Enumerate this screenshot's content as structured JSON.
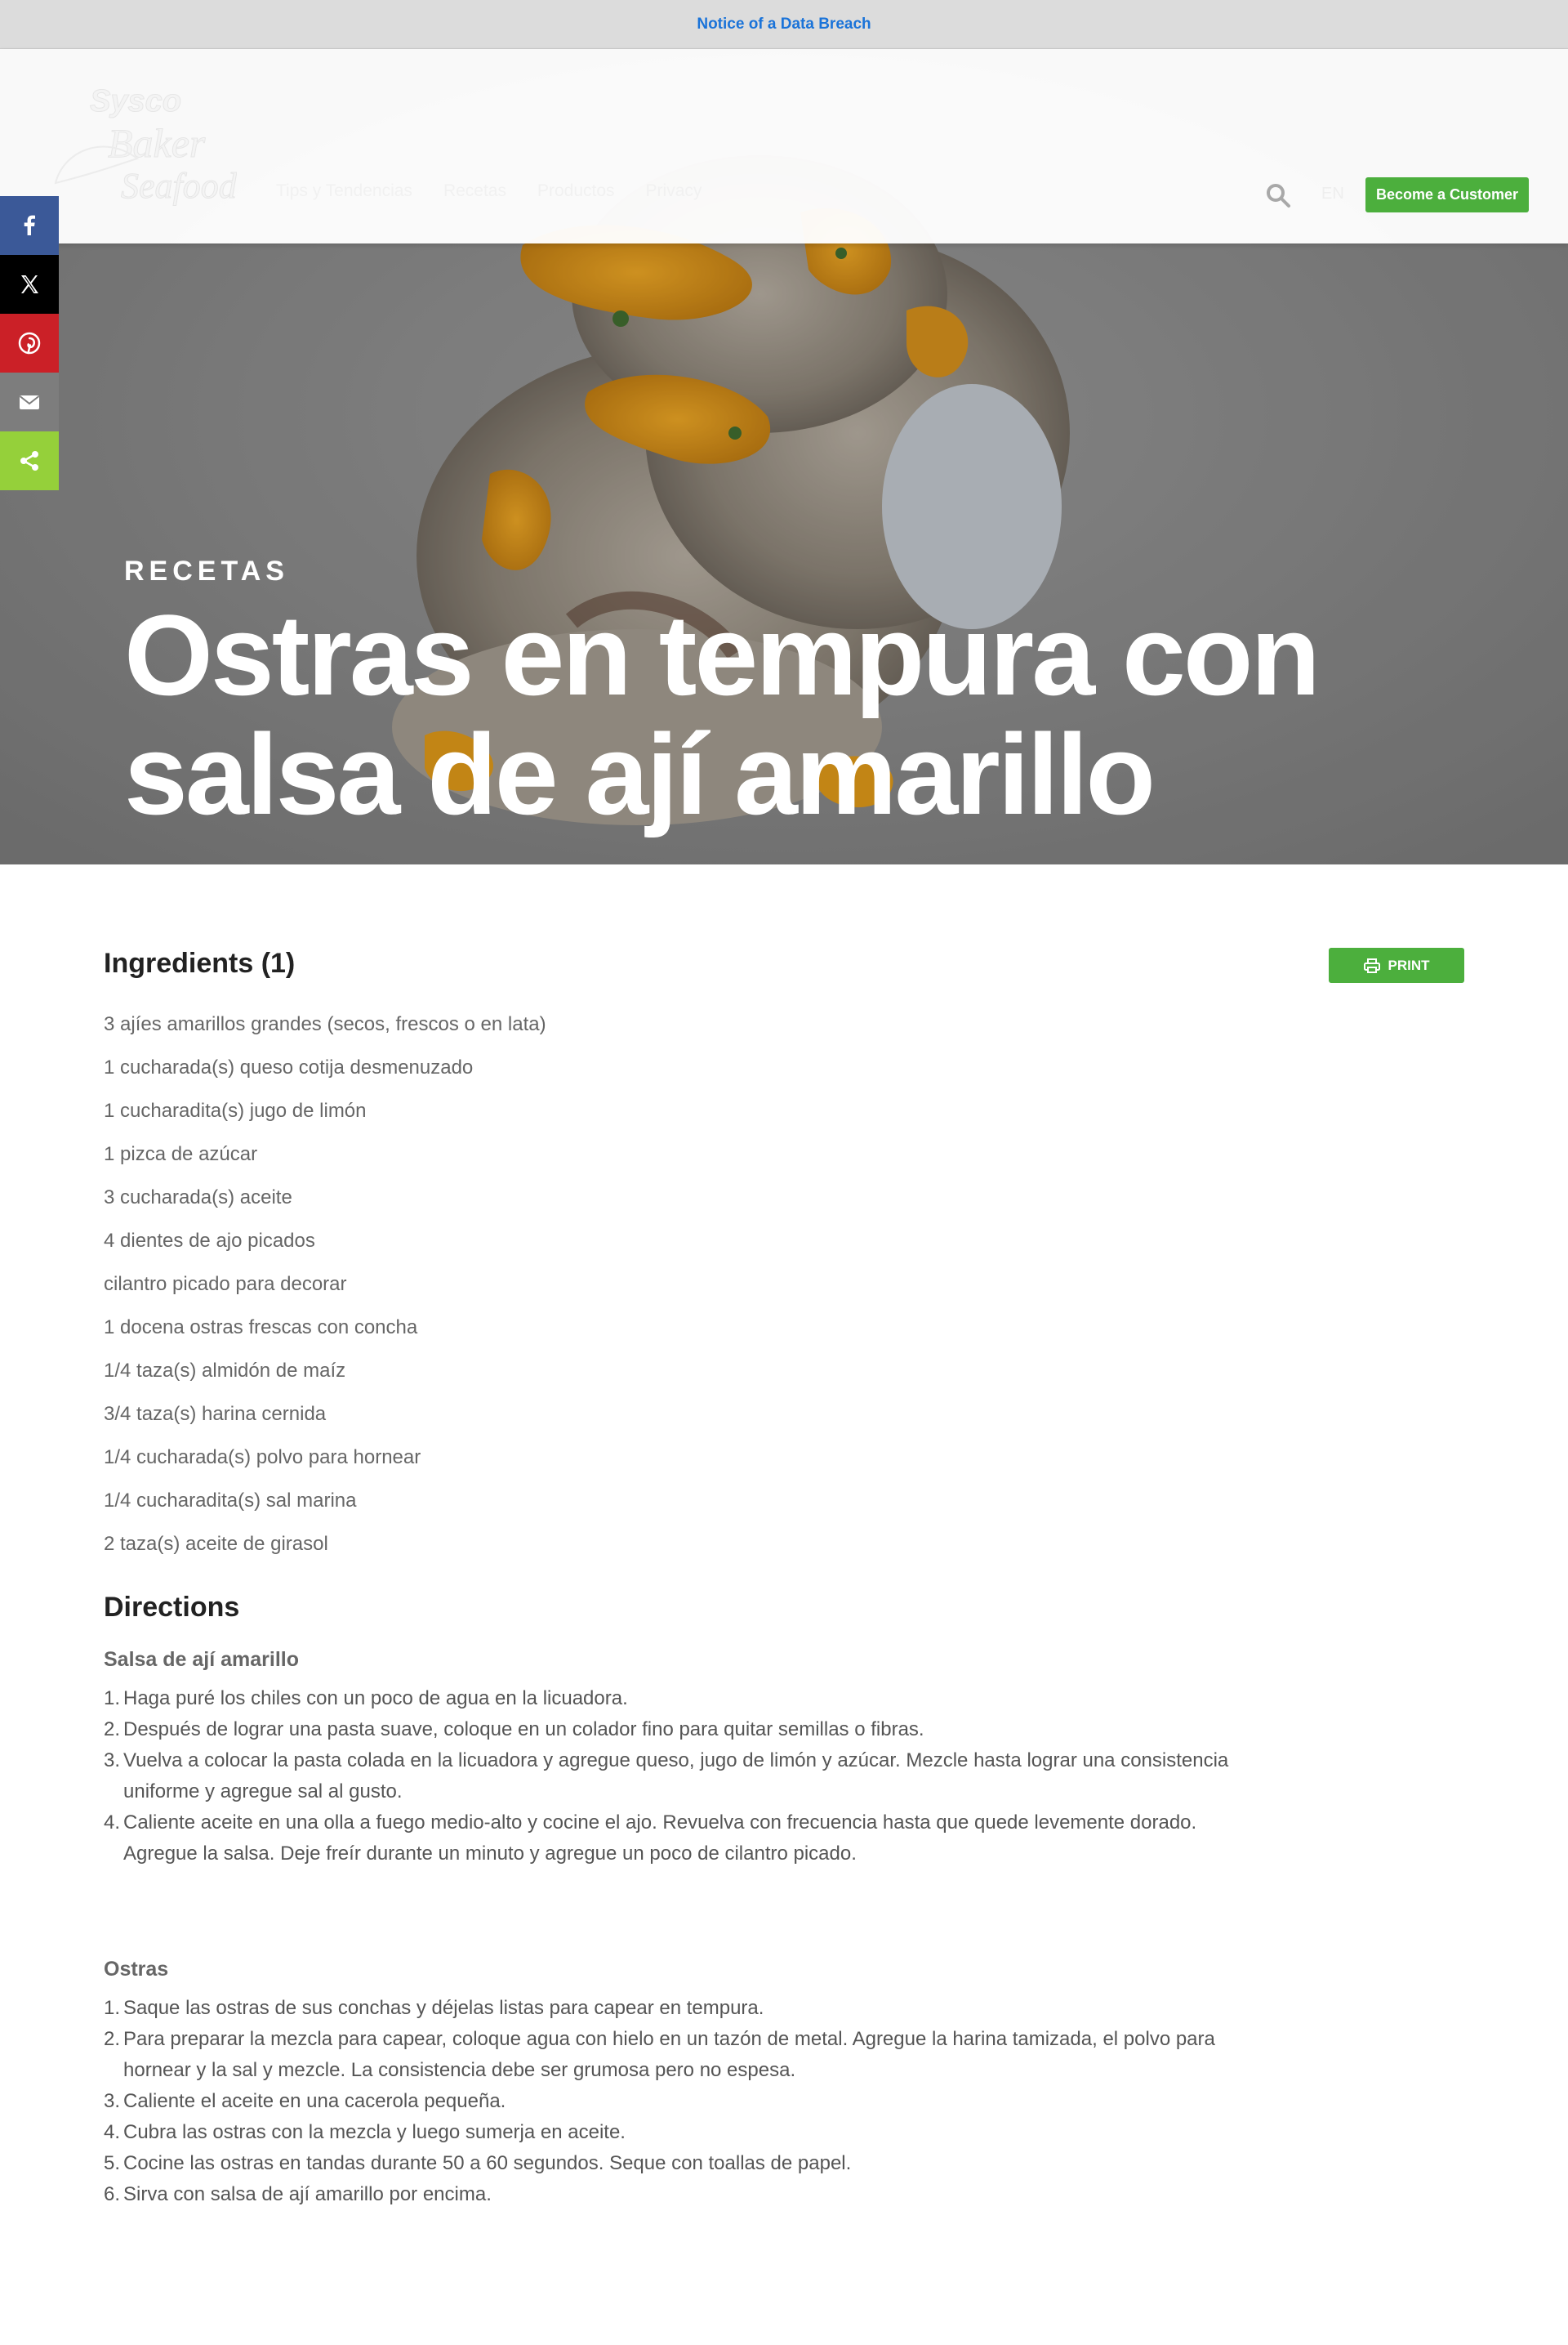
{
  "notice": {
    "label": "Notice of a Data Breach"
  },
  "header": {
    "logo_text": [
      "Sysco",
      "Baker",
      "Seafood"
    ],
    "nav": [
      "Tips y Tendencias",
      "Recetas",
      "Productos",
      "Privacy"
    ],
    "lang": "EN",
    "become_customer": "Become a Customer",
    "search_icon": "search-icon"
  },
  "share": [
    {
      "name": "facebook",
      "color": "#3b5998"
    },
    {
      "name": "x-twitter",
      "color": "#000000"
    },
    {
      "name": "pinterest",
      "color": "#cb2027"
    },
    {
      "name": "email",
      "color": "#7d7d7d"
    },
    {
      "name": "share",
      "color": "#95d03a"
    }
  ],
  "hero": {
    "category": "RECETAS",
    "title": "Ostras en tempura con salsa de ají amarillo"
  },
  "recipe": {
    "ingredients_title": "Ingredients (1)",
    "print_label": "PRINT",
    "ingredients": [
      "3 ajíes amarillos grandes (secos, frescos o en lata)",
      "1 cucharada(s) queso cotija desmenuzado",
      "1 cucharadita(s) jugo de limón",
      "1 pizca de azúcar",
      "3 cucharada(s) aceite",
      "4 dientes de ajo picados",
      "cilantro picado para decorar",
      "1 docena ostras frescas con concha",
      "1/4 taza(s) almidón de maíz",
      "3/4 taza(s) harina cernida",
      "1/4 cucharada(s) polvo para hornear",
      "1/4 cucharadita(s) sal marina",
      "2 taza(s) aceite de girasol"
    ],
    "directions_title": "Directions",
    "sections": [
      {
        "title": "Salsa de ají amarillo",
        "steps": [
          "Haga puré los chiles con un poco de agua en la licuadora.",
          "Después de lograr una pasta suave, coloque en un colador fino para quitar semillas o fibras.",
          "Vuelva a colocar la pasta colada en la licuadora y agregue queso, jugo de limón y azúcar. Mezcle hasta lograr una consistencia uniforme y agregue sal al gusto.",
          "Caliente aceite en una olla a fuego medio-alto y cocine el ajo. Revuelva con frecuencia hasta que quede levemente dorado. Agregue la salsa. Deje freír durante un minuto y agregue un poco de cilantro picado."
        ]
      },
      {
        "title": "Ostras",
        "steps": [
          "Saque las ostras de sus conchas y déjelas listas para capear en tempura.",
          "Para preparar la mezcla para capear, coloque agua con hielo en un tazón de metal. Agregue la harina tamizada, el polvo para hornear y la sal y mezcle. La consistencia debe ser grumosa pero no espesa.",
          "Caliente el aceite en una cacerola pequeña.",
          "Cubra las ostras con la mezcla y luego sumerja en aceite.",
          "Cocine las ostras en tandas durante 50 a 60 segundos. Seque con toallas de papel.",
          "Sirva con salsa de ají amarillo por encima."
        ]
      }
    ]
  },
  "colors": {
    "accent_green": "#4caf3d",
    "notice_link": "#1a73d9"
  }
}
